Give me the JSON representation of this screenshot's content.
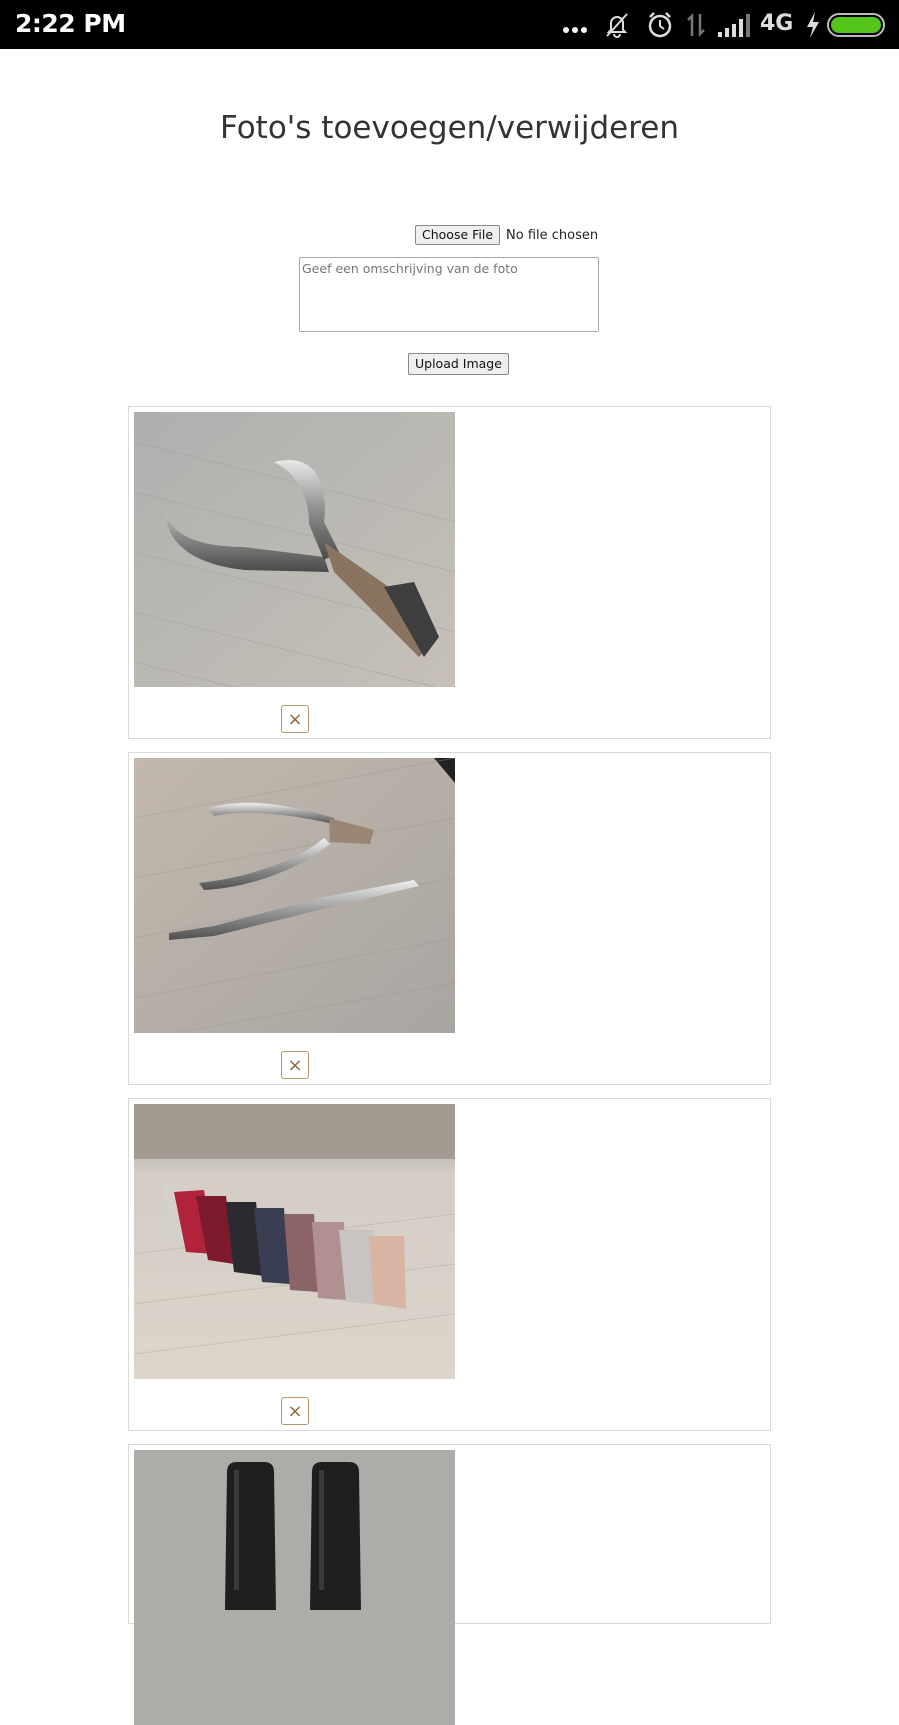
{
  "status_bar": {
    "time": "2:22 PM",
    "network": "4G",
    "icons": [
      "more-dots-icon",
      "mute-icon",
      "alarm-icon",
      "data-arrows-icon",
      "signal-icon",
      "network-label",
      "charging-icon",
      "battery-icon"
    ],
    "battery_color": "#55c51c"
  },
  "page": {
    "title": "Foto's toevoegen/verwijderen"
  },
  "form": {
    "choose_file_label": "Choose File",
    "no_file_text": "No file chosen",
    "description_placeholder": "Geef een omschrijving van de foto",
    "upload_label": "Upload Image"
  },
  "photos": [
    {
      "subject": "cuticle nippers on wooden surface",
      "delete_label": "×"
    },
    {
      "subject": "cuticle nippers and pusher tool",
      "delete_label": "×"
    },
    {
      "subject": "row of nail polish color swatches",
      "delete_label": "×"
    },
    {
      "subject": "black nail polish bottles",
      "delete_label": "×"
    }
  ],
  "colors": {
    "accent_border": "#b8956a",
    "text": "#333333"
  }
}
